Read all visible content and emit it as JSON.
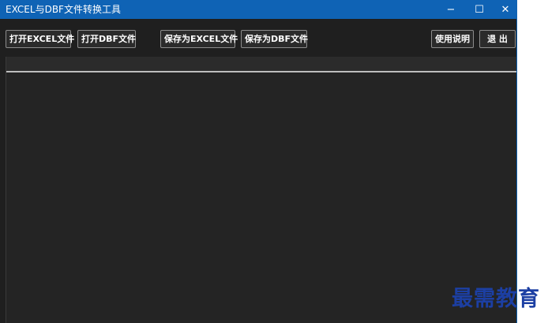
{
  "window": {
    "title": "EXCEL与DBF文件转换工具",
    "controls": {
      "minimize": "−",
      "maximize": "☐",
      "close": "✕"
    }
  },
  "toolbar": {
    "open_excel_label": "打开EXCEL文件",
    "open_dbf_label": "打开DBF文件",
    "save_excel_label": "保存为EXCEL文件",
    "save_dbf_label": "保存为DBF文件",
    "help_label": "使用说明",
    "exit_label": "退 出"
  },
  "watermark": {
    "text": "最需教育"
  }
}
